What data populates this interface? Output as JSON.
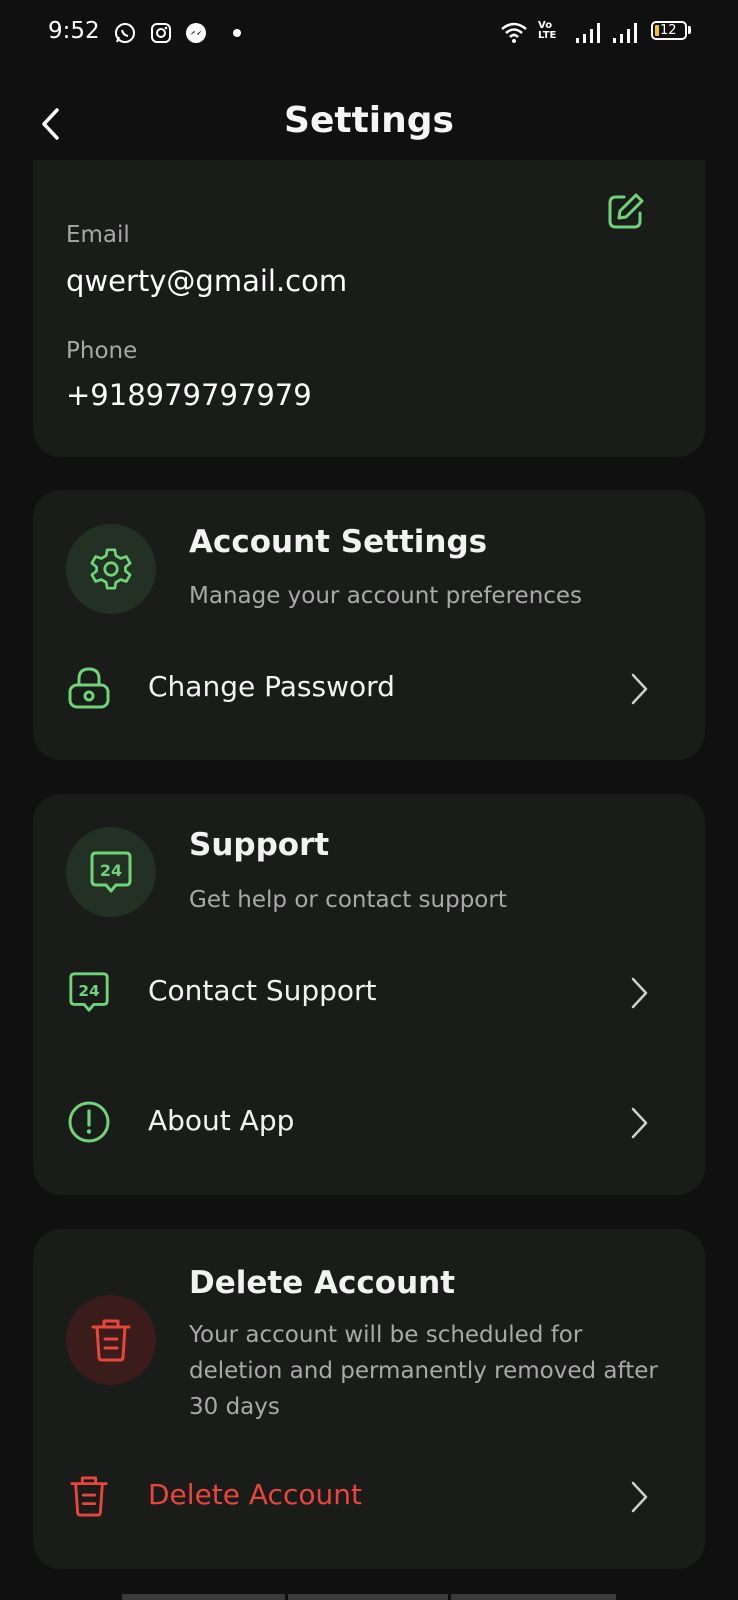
{
  "status_bar": {
    "time": "9:52",
    "notification_icons": [
      "whatsapp-icon",
      "instagram-icon",
      "messenger-icon"
    ],
    "network_label_top": "Vo",
    "network_label_bottom": "LTE",
    "battery": "12"
  },
  "header": {
    "title": "Settings"
  },
  "profile": {
    "email_label": "Email",
    "email_value": "qwerty@gmail.com",
    "phone_label": "Phone",
    "phone_value": "+918979797979"
  },
  "account_settings": {
    "title": "Account Settings",
    "subtitle": "Manage your account preferences",
    "items": [
      {
        "label": "Change Password",
        "icon": "lock-icon"
      }
    ]
  },
  "support": {
    "title": "Support",
    "subtitle": "Get help or contact support",
    "items": [
      {
        "label": "Contact Support",
        "icon": "support-24-icon"
      },
      {
        "label": "About App",
        "icon": "info-icon"
      }
    ]
  },
  "delete_section": {
    "title": "Delete Account",
    "subtitle": "Your account will be scheduled for deletion and permanently removed after 30 days",
    "items": [
      {
        "label": "Delete Account",
        "icon": "trash-icon"
      }
    ]
  },
  "colors": {
    "background": "#101010",
    "card": "#1a1c1a",
    "accent_green": "#6fd37a",
    "danger_red": "#e8453c"
  }
}
